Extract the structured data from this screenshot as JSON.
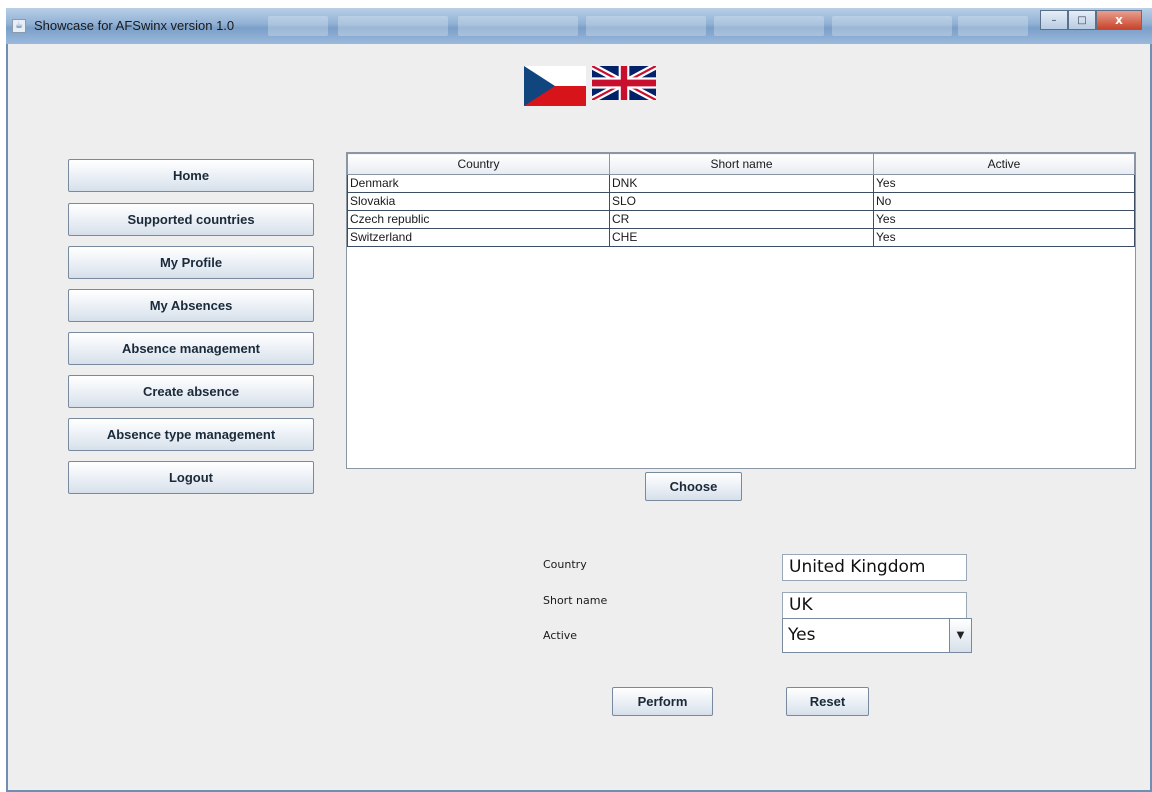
{
  "window": {
    "title": "Showcase for AFSwinx version 1.0",
    "controls": {
      "minimize_icon": "–",
      "maximize_icon": "□",
      "close_icon": "x"
    }
  },
  "flags": [
    {
      "name": "czech-flag",
      "language": "Czech"
    },
    {
      "name": "uk-flag",
      "language": "English"
    }
  ],
  "nav": {
    "items": [
      {
        "label": "Home"
      },
      {
        "label": "Supported countries"
      },
      {
        "label": "My Profile"
      },
      {
        "label": "My Absences"
      },
      {
        "label": "Absence management"
      },
      {
        "label": "Create absence"
      },
      {
        "label": "Absence type management"
      },
      {
        "label": "Logout"
      }
    ]
  },
  "table": {
    "columns": [
      "Country",
      "Short name",
      "Active"
    ],
    "rows": [
      [
        "Denmark",
        "DNK",
        "Yes"
      ],
      [
        "Slovakia",
        "SLO",
        "No"
      ],
      [
        "Czech republic",
        "CR",
        "Yes"
      ],
      [
        "Switzerland",
        "CHE",
        "Yes"
      ]
    ]
  },
  "actions": {
    "choose_label": "Choose",
    "perform_label": "Perform",
    "reset_label": "Reset"
  },
  "form": {
    "country_label": "Country",
    "country_value": "United Kingdom",
    "short_name_label": "Short name",
    "short_name_value": "UK",
    "active_label": "Active",
    "active_value": "Yes",
    "active_dropdown_icon": "▼"
  },
  "colors": {
    "flag_cz_white": "#ffffff",
    "flag_cz_red": "#d7141a",
    "flag_cz_blue": "#11457e",
    "flag_uk_blue": "#012169",
    "flag_uk_red": "#c8102e"
  }
}
